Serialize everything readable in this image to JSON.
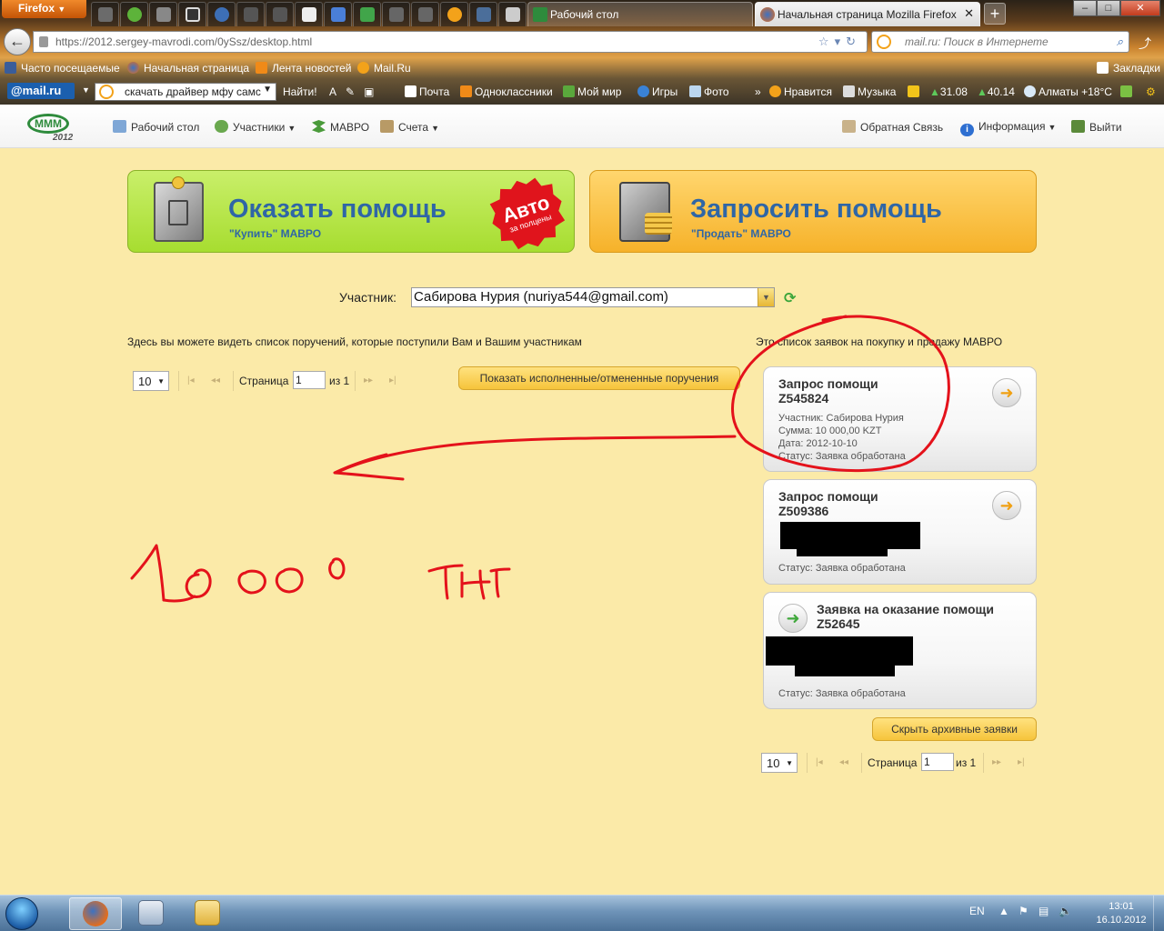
{
  "browser": {
    "menu_label": "Firefox",
    "tabs": [
      {
        "label": "Рабочий стол",
        "active": true
      },
      {
        "label": "Начальная страница Mozilla Firefox",
        "active": false
      }
    ],
    "new_tab": "+",
    "window_buttons": {
      "minimize": "–",
      "maximize": "□",
      "close": "✕"
    },
    "url": "https://2012.sergey-mavrodi.com/0ySsz/desktop.html",
    "search_placeholder": "mail.ru: Поиск в Интернете",
    "bookmarks": [
      "Часто посещаемые",
      "Начальная страница",
      "Лента новостей",
      "Mail.Ru"
    ],
    "bookmarks_right": "Закладки"
  },
  "mailbar": {
    "logo": "@mail.ru",
    "search_value": "скачать драйвер мфу самс",
    "find_label": "Найти!",
    "items": [
      "Почта",
      "Одноклассники",
      "Мой мир",
      "Игры",
      "Фото",
      "Нравится",
      "Музыка"
    ],
    "usd": "31.08",
    "eur": "40.14",
    "weather": "Алматы +18°C",
    "more": "»"
  },
  "site": {
    "logo_text": "МММ",
    "logo_year": "2012",
    "nav": [
      {
        "label": "Рабочий стол",
        "dropdown": false
      },
      {
        "label": "Участники",
        "dropdown": true
      },
      {
        "label": "МАВРО",
        "dropdown": false
      },
      {
        "label": "Счета",
        "dropdown": true
      }
    ],
    "nav_right": [
      {
        "label": "Обратная Связь",
        "dropdown": false
      },
      {
        "label": "Информация",
        "dropdown": true
      },
      {
        "label": "Выйти",
        "dropdown": false
      }
    ]
  },
  "content": {
    "give_help": {
      "title": "Оказать помощь",
      "subtitle": "\"Купить\" МАВРО",
      "badge_main": "Авто",
      "badge_sub": "за полцены"
    },
    "request_help": {
      "title": "Запросить помощь",
      "subtitle": "\"Продать\" МАВРО"
    },
    "participant_label": "Участник:",
    "participant_value": "Сабирова Нурия (nuriya544@gmail.com)",
    "left_info": "Здесь вы можете видеть список поручений, которые поступили Вам и Вашим участникам",
    "right_info": "Это список заявок на покупку и продажу МАВРО",
    "pager_left": {
      "per_page": "10",
      "page_label": "Страница",
      "page_value": "1",
      "of_label": "из 1"
    },
    "pager_right": {
      "per_page": "10",
      "page_label": "Страница",
      "page_value": "1",
      "of_label": "из 1"
    },
    "show_done_button": "Показать исполненные/отмененные поручения",
    "hide_archive_button": "Скрыть архивные заявки",
    "cards": [
      {
        "title": "Запрос помощи",
        "id": "Z545824",
        "participant": "Участник: Сабирова Нурия",
        "amount": "Сумма: 10 000,00 KZT",
        "date": "Дата: 2012-10-10",
        "status": "Статус: Заявка обработана"
      },
      {
        "title": "Запрос помощи",
        "id": "Z509386",
        "status": "Статус: Заявка обработана"
      },
      {
        "title": "Заявка на оказание помощи",
        "id": "Z52645",
        "status": "Статус: Заявка обработана"
      }
    ]
  },
  "taskbar": {
    "lang": "EN",
    "time": "13:01",
    "date": "16.10.2012"
  },
  "colors": {
    "page_bg": "#fbeaa8",
    "green_button": "#b4e43f",
    "orange_button": "#f8c03f",
    "title_blue": "#2f66a6",
    "annotation_red": "#e4121b"
  }
}
